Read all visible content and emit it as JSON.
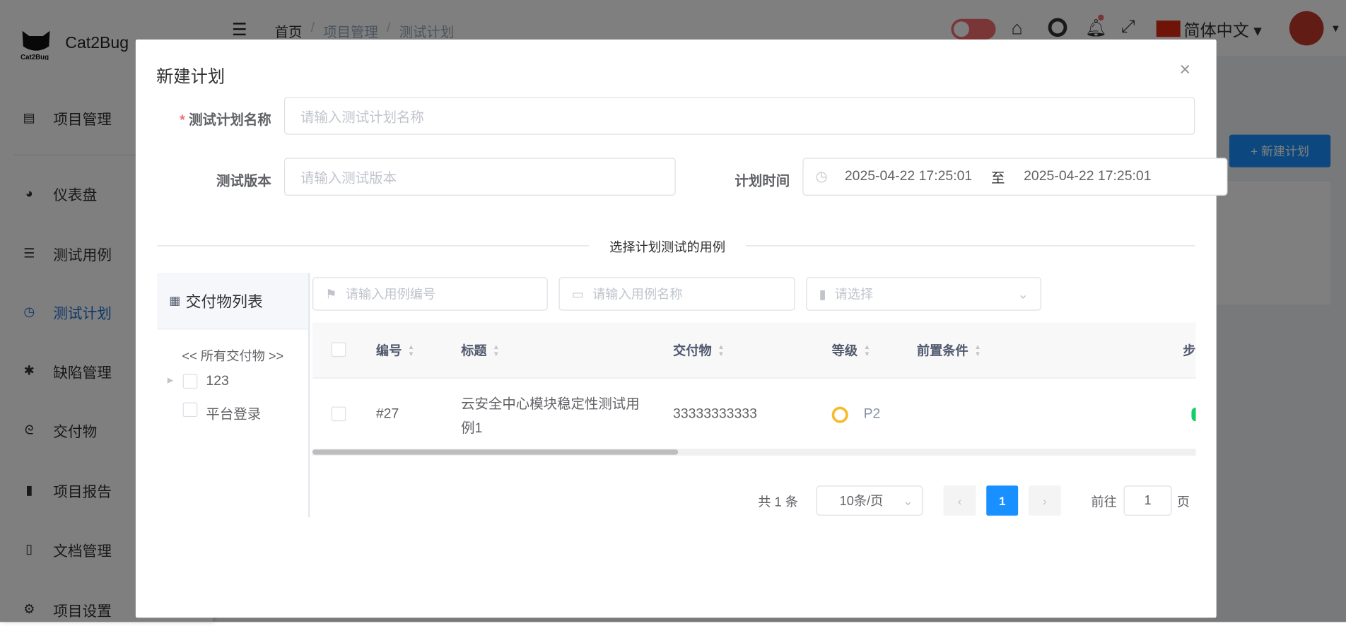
{
  "app": {
    "name": "Cat2Bug",
    "logo_text": "Cat2Bug"
  },
  "sidebar": {
    "items": [
      {
        "label": "项目管理",
        "icon": "folder-icon"
      },
      {
        "label": "仪表盘",
        "icon": "dashboard-icon"
      },
      {
        "label": "测试用例",
        "icon": "list-icon"
      },
      {
        "label": "测试计划",
        "icon": "clock-icon"
      },
      {
        "label": "缺陷管理",
        "icon": "bug-icon"
      },
      {
        "label": "交付物",
        "icon": "tree-icon"
      },
      {
        "label": "项目报告",
        "icon": "bar-chart-icon"
      },
      {
        "label": "文档管理",
        "icon": "book-icon"
      },
      {
        "label": "项目设置",
        "icon": "gear-icon"
      }
    ],
    "active": "测试计划"
  },
  "header": {
    "breadcrumb": [
      "首页",
      "项目管理",
      "测试计划"
    ],
    "language": "简体中文"
  },
  "page": {
    "new_plan_button": "+ 新建计划"
  },
  "dialog": {
    "title": "新建计划",
    "name_label": "测试计划名称",
    "name_placeholder": "请输入测试计划名称",
    "version_label": "测试版本",
    "version_placeholder": "请输入测试版本",
    "time_label": "计划时间",
    "start_time": "2025-04-22 17:25:01",
    "range_separator": "至",
    "end_time": "2025-04-22 17:25:01",
    "divider_text": "选择计划测试的用例",
    "tree": {
      "title": "交付物列表",
      "all_label": "<< 所有交付物 >>",
      "nodes": [
        "123",
        "平台登录"
      ]
    },
    "filters": {
      "number_placeholder": "请输入用例编号",
      "name_placeholder": "请输入用例名称",
      "level_placeholder": "请选择"
    },
    "table": {
      "columns": [
        "编号",
        "标题",
        "交付物",
        "等级",
        "前置条件",
        "步"
      ],
      "rows": [
        {
          "number": "#27",
          "title": "云安全中心模块稳定性测试用例1",
          "deliverable": "33333333333",
          "level": "P2",
          "precondition": ""
        }
      ]
    },
    "pagination": {
      "total": "共 1 条",
      "page_size": "10条/页",
      "current_page": "1",
      "goto_label": "前往",
      "goto_value": "1",
      "page_suffix": "页"
    }
  },
  "colors": {
    "primary": "#1890ff",
    "active_nav": "#1f6fd0",
    "level_p2": "#f7ba2a"
  }
}
